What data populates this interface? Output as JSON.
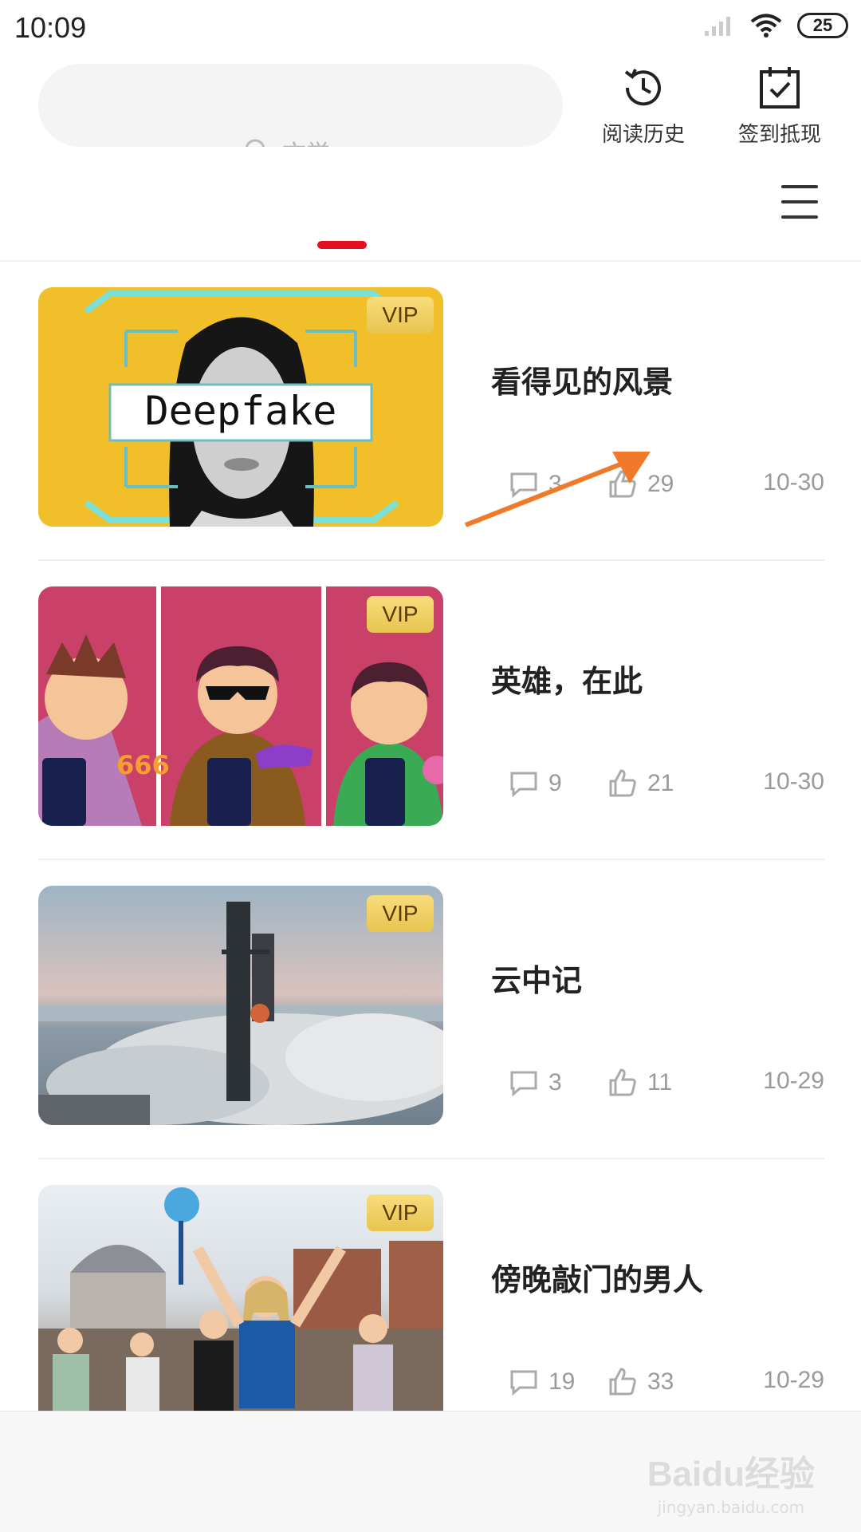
{
  "status_bar": {
    "time": "10:09",
    "battery": "25"
  },
  "header": {
    "search_placeholder": "文学",
    "history_label": "阅读历史",
    "checkin_label": "签到抵现"
  },
  "feed": [
    {
      "vip": "VIP",
      "thumb_text": "Deepfake",
      "title": "看得见的风景",
      "comments": "3",
      "likes": "29",
      "date": "10-30"
    },
    {
      "vip": "VIP",
      "thumb_text": "666",
      "title": "英雄，在此",
      "comments": "9",
      "likes": "21",
      "date": "10-30"
    },
    {
      "vip": "VIP",
      "title": "云中记",
      "comments": "3",
      "likes": "11",
      "date": "10-29"
    },
    {
      "vip": "VIP",
      "title": "傍晚敲门的男人",
      "comments": "19",
      "likes": "33",
      "date": "10-29"
    }
  ],
  "watermark": {
    "brand": "Baidu经验",
    "url": "jingyan.baidu.com"
  },
  "colors": {
    "accent": "#e5101f",
    "annotation_arrow": "#f07a2a",
    "vip_gold": "#f0cf63"
  }
}
